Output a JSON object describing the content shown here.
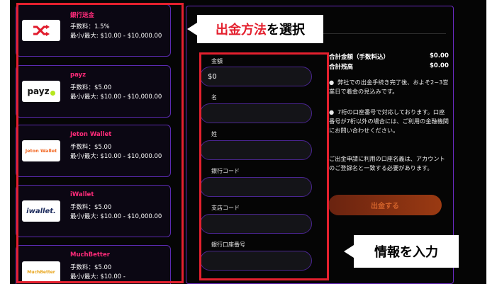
{
  "methods": [
    {
      "name": "銀行送金",
      "fee": "手数料：1.5%",
      "limit": "最小/最大: $10.00 - $10,000.00",
      "logo": "shuffle-icon"
    },
    {
      "name": "payz",
      "fee": "手数料：$5.00",
      "limit": "最小/最大: $10.00 - $10,000.00",
      "logo": "payz"
    },
    {
      "name": "Jeton Wallet",
      "fee": "手数料：$5.00",
      "limit": "最小/最大: $10.00 - $10,000.00",
      "logo": "Jeton Wallet"
    },
    {
      "name": "iWallet",
      "fee": "手数料：$5.00",
      "limit": "最小/最大: $10.00 - $10,000.00",
      "logo": "iwallet."
    },
    {
      "name": "MuchBetter",
      "fee": "手数料：$5.00",
      "limit": "最小/最大: $10.00 -",
      "logo": "MuchBetter"
    }
  ],
  "form": {
    "amount_label": "金額",
    "amount_value": "$0",
    "first_name_label": "名",
    "last_name_label": "姓",
    "bank_code_label": "銀行コード",
    "branch_code_label": "支店コード",
    "account_number_label": "銀行口座番号"
  },
  "summary": {
    "total_label": "合計金額（手数料込）",
    "total_value": "$0.00",
    "balance_label": "合計残高",
    "balance_value": "$0.00"
  },
  "notes": {
    "note1": "弊社での出金手続き完了後、およそ2~3営業日で着金の見込みです。",
    "note2": "7桁の口座番号で対応しております。口座番号が7桁以外の場合には、ご利用の金融機関にお問い合わせください。",
    "note3": "ご出金申請に利用の口座名義は、アカウントのご登録名と一致する必要があります。",
    "bullet": "●"
  },
  "submit_label": "出金する",
  "callouts": {
    "select_method_part1": "出金方法",
    "select_method_part2": "を選択",
    "enter_info": "情報を入力"
  },
  "colors": {
    "accent_pink": "#ff2b7a",
    "accent_purple": "#5b2ab0",
    "callout_red": "#e4202e",
    "submit_orange": "#d2622a"
  }
}
